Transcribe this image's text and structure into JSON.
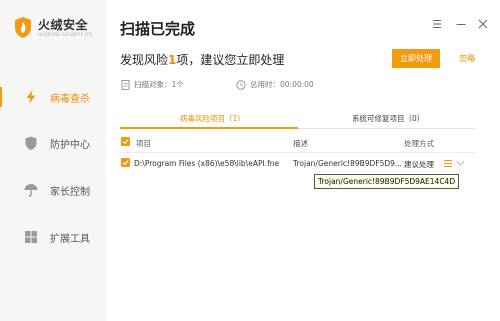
{
  "app": {
    "name": "火绒安全",
    "subtitle": "HUORONG SECURITY LTD"
  },
  "sidebar": {
    "items": [
      {
        "label": "病毒查杀",
        "icon": "lightning-icon",
        "active": true
      },
      {
        "label": "防护中心",
        "icon": "shield-icon",
        "active": false
      },
      {
        "label": "家长控制",
        "icon": "umbrella-icon",
        "active": false
      },
      {
        "label": "扩展工具",
        "icon": "grid-icon",
        "active": false
      }
    ]
  },
  "header": {
    "title": "扫描已完成",
    "controls": [
      "menu-icon",
      "minimize-icon",
      "close-icon"
    ]
  },
  "summary": {
    "prefix": "发现风险",
    "count": "1",
    "suffix": "项，建议您立即处理",
    "primary_button": "立即处理",
    "secondary_link": "忽略",
    "scan_objects": "扫描对象：1个",
    "elapsed": "总用时：00:00:00"
  },
  "tabs": [
    {
      "label": "病毒风险项目（1）",
      "active": true
    },
    {
      "label": "系统可修复项目（0）",
      "active": false
    }
  ],
  "table": {
    "columns": [
      "项目",
      "描述",
      "处理方式"
    ],
    "rows": [
      {
        "checked": true,
        "item": "D:\\Program Files (x86)\\e58\\lib\\eAPI.fne",
        "description": "Trojan/Generic!89B9DF5D9...",
        "action": "建议处理"
      }
    ]
  },
  "tooltip": {
    "text": "Trojan/Generic!89B9DF5D9AE14C4D"
  },
  "colors": {
    "accent": "#f39a11",
    "accent_text": "#f08a00",
    "sidebar_bg": "#f6f6f6"
  }
}
